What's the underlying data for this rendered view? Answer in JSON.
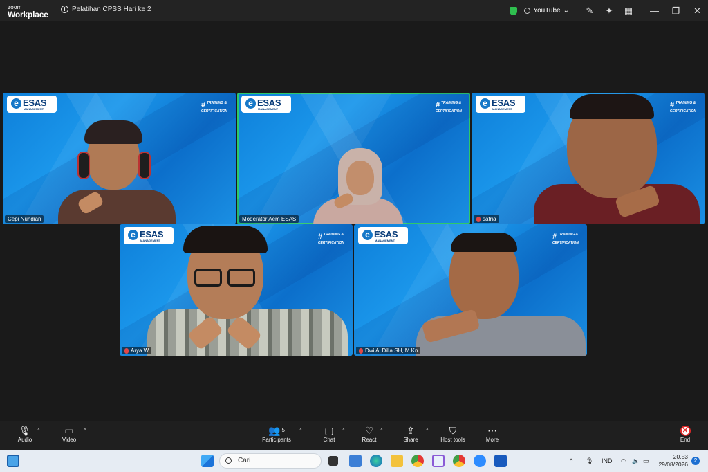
{
  "app": {
    "logo_small": "zoom",
    "logo_big": "Workplace",
    "meeting_title": "Pelatihan CPSS Hari ke 2"
  },
  "titlebar": {
    "youtube_label": "YouTube",
    "shield_color": "#2fbf4f"
  },
  "branding": {
    "logo_text": "ESAS",
    "logo_sub": "MANAGEMENT",
    "tag_line1": "TRAINING &",
    "tag_line2": "CERTIFICATION"
  },
  "participants": [
    {
      "name": "Cepi Nuhdian",
      "muted": false,
      "active": false
    },
    {
      "name": "Moderator Aem ESAS",
      "muted": false,
      "active": true
    },
    {
      "name": "satria",
      "muted": true,
      "active": false
    },
    {
      "name": "Arya W",
      "muted": true,
      "active": false
    },
    {
      "name": "Dwi Al Dilla SH, M.Kn",
      "muted": true,
      "active": false
    }
  ],
  "toolbar": {
    "audio": "Audio",
    "video": "Video",
    "participants": "Participants",
    "participants_count": "5",
    "chat": "Chat",
    "react": "React",
    "share": "Share",
    "host_tools": "Host tools",
    "more": "More",
    "end": "End",
    "end_color": "#e02828"
  },
  "taskbar": {
    "search_placeholder": "Cari",
    "lang": "IND",
    "time": "20.53",
    "date": "29/08/2026",
    "notifications": "2"
  },
  "colors": {
    "accent_active": "#2ec96a",
    "tile_blue": "#1b97eb"
  }
}
